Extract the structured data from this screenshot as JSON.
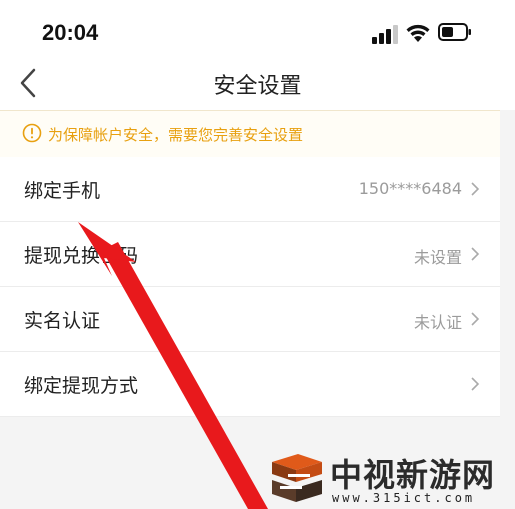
{
  "status_bar": {
    "time": "20:04",
    "signal_icon": "signal-icon",
    "wifi_icon": "wifi-icon",
    "battery_icon": "battery-icon"
  },
  "nav": {
    "title": "安全设置",
    "back_icon": "chevron-left-icon"
  },
  "notice": {
    "text": "为保障帐户安全，需要您完善安全设置",
    "icon": "warning-circle-icon",
    "color": "#e8a010"
  },
  "rows": [
    {
      "label": "绑定手机",
      "value": "150****6484"
    },
    {
      "label": "提现兑换密码",
      "value": "未设置"
    },
    {
      "label": "实名认证",
      "value": "未认证"
    },
    {
      "label": "绑定提现方式",
      "value": ""
    }
  ],
  "annotation": {
    "arrow_color": "#e8191c"
  },
  "watermark": {
    "title": "中视新游网",
    "url": "www.315ict.com"
  }
}
